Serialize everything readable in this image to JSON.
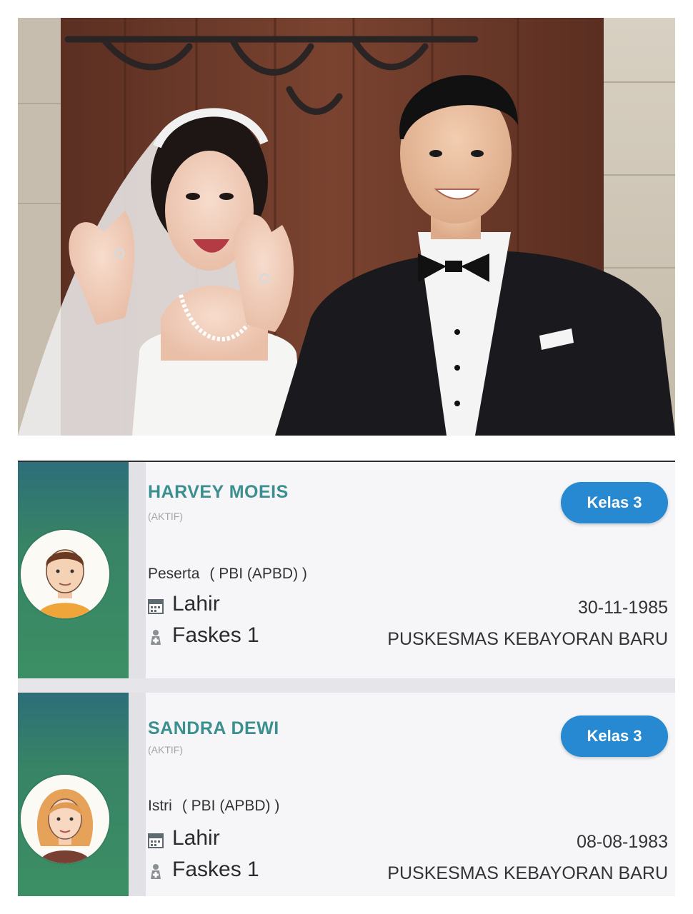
{
  "cards": [
    {
      "name": "HARVEY MOEIS",
      "status": "(AKTIF)",
      "badge": "Kelas 3",
      "member_role": "Peserta",
      "member_type": "( PBI (APBD) )",
      "lahir_label": "Lahir",
      "lahir_value": "30-11-1985",
      "faskes_label": "Faskes 1",
      "faskes_value": "PUSKESMAS KEBAYORAN BARU",
      "avatar_icon": "male-avatar-icon"
    },
    {
      "name": "SANDRA DEWI",
      "status": "(AKTIF)",
      "badge": "Kelas 3",
      "member_role": "Istri",
      "member_type": "( PBI (APBD) )",
      "lahir_label": "Lahir",
      "lahir_value": "08-08-1983",
      "faskes_label": "Faskes 1",
      "faskes_value": "PUSKESMAS KEBAYORAN BARU",
      "avatar_icon": "female-avatar-icon"
    }
  ],
  "colors": {
    "side_panel": "#3c8f64",
    "name_text": "#3b8f8f",
    "badge_bg": "#2789d1",
    "card_bg": "#f6f6f8"
  },
  "icons": [
    "calendar-icon",
    "hospital-icon"
  ]
}
